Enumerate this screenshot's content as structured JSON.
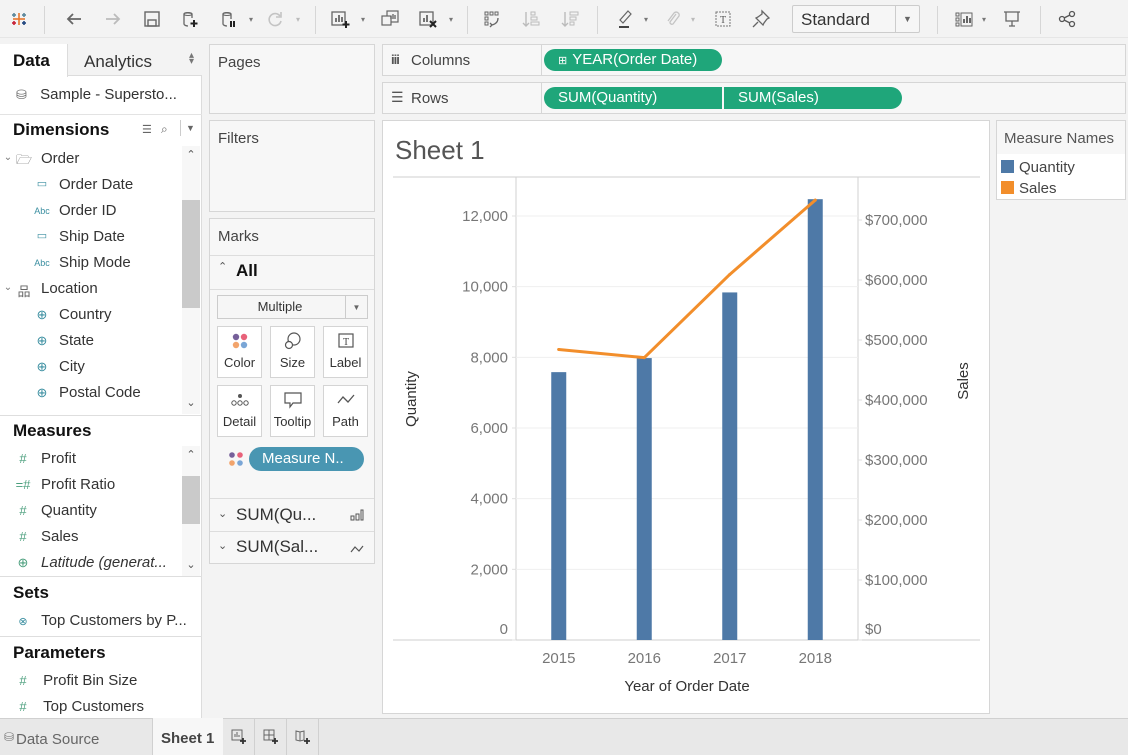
{
  "toolbar": {
    "items": [
      {
        "name": "tableau-logo-icon"
      },
      {
        "name": "undo-icon"
      },
      {
        "name": "redo-icon"
      },
      {
        "name": "save-icon"
      },
      {
        "name": "new-data-source-icon"
      },
      {
        "name": "pause-auto-updates-icon"
      },
      {
        "name": "refresh-icon"
      },
      {
        "name": "new-worksheet-icon"
      },
      {
        "name": "duplicate-sheet-icon"
      },
      {
        "name": "clear-sheet-icon"
      },
      {
        "name": "swap-rows-columns-icon"
      },
      {
        "name": "sort-ascending-icon"
      },
      {
        "name": "sort-descending-icon"
      },
      {
        "name": "highlight-icon"
      },
      {
        "name": "group-members-icon"
      },
      {
        "name": "show-mark-labels-icon"
      },
      {
        "name": "fix-axes-icon"
      },
      {
        "name": "show-me-icon"
      },
      {
        "name": "presentation-mode-icon"
      },
      {
        "name": "share-icon"
      }
    ],
    "fit_select": "Standard"
  },
  "left_pane": {
    "tabs": {
      "data": "Data",
      "analytics": "Analytics"
    },
    "data_source": "Sample - Supersto...",
    "dimensions": {
      "title": "Dimensions",
      "items": [
        {
          "label": "Order",
          "icon": "folder",
          "level": 0
        },
        {
          "label": "Order Date",
          "icon": "calendar",
          "level": 1
        },
        {
          "label": "Order ID",
          "icon": "abc",
          "level": 1
        },
        {
          "label": "Ship Date",
          "icon": "calendar",
          "level": 1
        },
        {
          "label": "Ship Mode",
          "icon": "abc",
          "level": 1
        },
        {
          "label": "Location",
          "icon": "hierarchy",
          "level": 0
        },
        {
          "label": "Country",
          "icon": "globe",
          "level": 1
        },
        {
          "label": "State",
          "icon": "globe",
          "level": 1
        },
        {
          "label": "City",
          "icon": "globe",
          "level": 1
        },
        {
          "label": "Postal Code",
          "icon": "globe",
          "level": 1
        }
      ]
    },
    "measures": {
      "title": "Measures",
      "items": [
        {
          "label": "Profit",
          "icon": "#"
        },
        {
          "label": "Profit Ratio",
          "icon": "=#"
        },
        {
          "label": "Quantity",
          "icon": "#"
        },
        {
          "label": "Sales",
          "icon": "#"
        },
        {
          "label": "Latitude (generat...",
          "icon": "globe"
        }
      ]
    },
    "sets": {
      "title": "Sets",
      "items": [
        {
          "label": "Top Customers by P..."
        }
      ]
    },
    "parameters": {
      "title": "Parameters",
      "items": [
        {
          "label": "Profit Bin Size"
        },
        {
          "label": "Top Customers"
        }
      ]
    }
  },
  "shelves": {
    "pages": "Pages",
    "filters": "Filters",
    "columns_label": "Columns",
    "rows_label": "Rows",
    "columns_pills": [
      "YEAR(Order Date)"
    ],
    "rows_pills": [
      "SUM(Quantity)",
      "SUM(Sales)"
    ]
  },
  "marks": {
    "title": "Marks",
    "all_label": "All",
    "mark_type": "Multiple",
    "buttons": [
      "Color",
      "Size",
      "Label",
      "Detail",
      "Tooltip",
      "Path"
    ],
    "color_pill": "Measure N..",
    "sub_cards": [
      "SUM(Qu...",
      "SUM(Sal..."
    ]
  },
  "sheet": {
    "title": "Sheet 1"
  },
  "legend": {
    "title": "Measure Names",
    "items": [
      {
        "label": "Quantity",
        "color": "#4e79a7"
      },
      {
        "label": "Sales",
        "color": "#f28e2b"
      }
    ]
  },
  "chart_data": {
    "type": "bar",
    "title": "Sheet 1",
    "categories": [
      "2015",
      "2016",
      "2017",
      "2018"
    ],
    "xlabel": "Year of Order Date",
    "series": [
      {
        "name": "Quantity",
        "type": "bar",
        "axis": "left",
        "color": "#4e79a7",
        "values": [
          7581,
          7979,
          9837,
          12476
        ]
      },
      {
        "name": "Sales",
        "type": "line",
        "axis": "right",
        "color": "#f28e2b",
        "values": [
          484247,
          470533,
          609206,
          733215
        ]
      }
    ],
    "y_left": {
      "label": "Quantity",
      "ylim": [
        0,
        13000
      ],
      "ticks": [
        0,
        2000,
        4000,
        6000,
        8000,
        10000,
        12000
      ],
      "tick_labels": [
        "0",
        "2,000",
        "4,000",
        "6,000",
        "8,000",
        "10,000",
        "12,000"
      ]
    },
    "y_right": {
      "label": "Sales",
      "ylim": [
        0,
        760000
      ],
      "ticks": [
        0,
        100000,
        200000,
        300000,
        400000,
        500000,
        600000,
        700000
      ],
      "tick_labels": [
        "$0",
        "$100,000",
        "$200,000",
        "$300,000",
        "$400,000",
        "$500,000",
        "$600,000",
        "$700,000"
      ]
    },
    "grid": true,
    "legend": "right"
  },
  "bottom_tabs": {
    "data_source": "Data Source",
    "sheets": [
      "Sheet 1"
    ],
    "new_buttons": [
      {
        "name": "new-worksheet-tab-icon"
      },
      {
        "name": "new-dashboard-tab-icon"
      },
      {
        "name": "new-story-tab-icon"
      }
    ]
  }
}
